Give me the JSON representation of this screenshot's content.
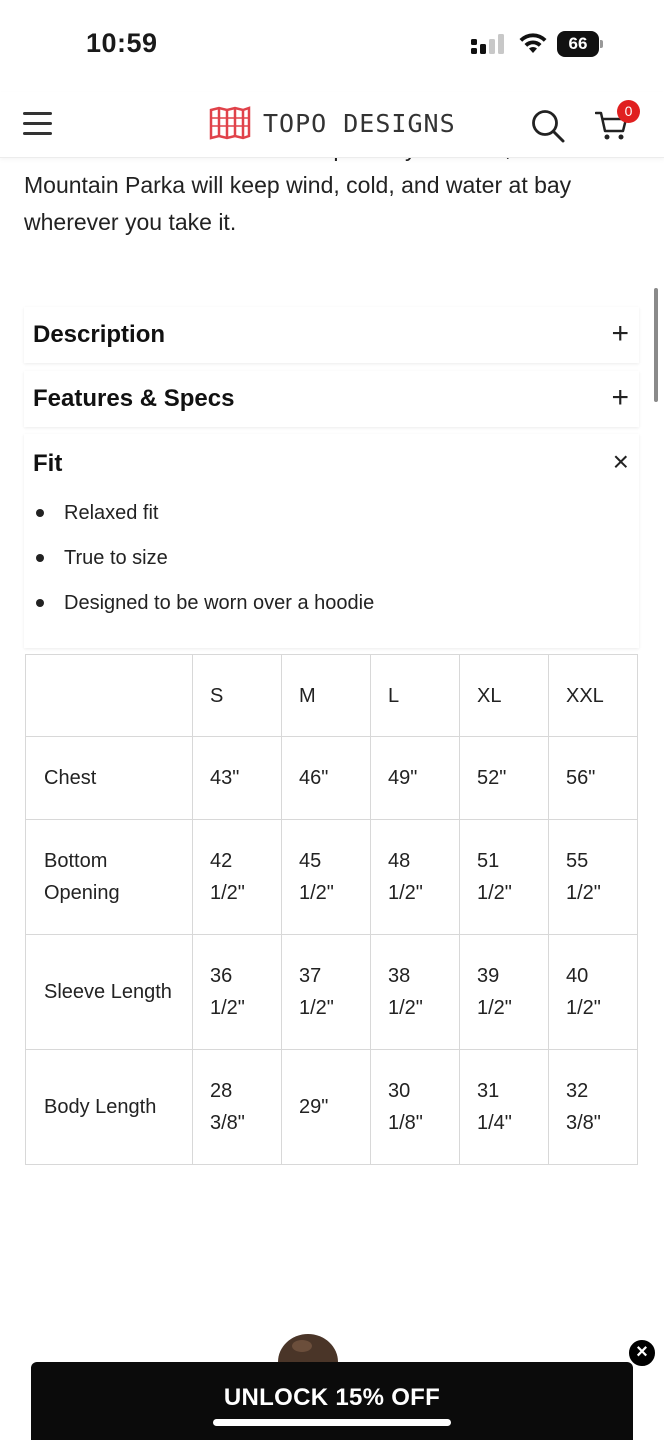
{
  "status_bar": {
    "time": "10:59",
    "battery": "66"
  },
  "header": {
    "brand": "TOPO DESIGNS",
    "cart_count": "0",
    "brand_color": "#e0424a"
  },
  "intro": {
    "text": "seams and a breathable waterproof nylon outer, the Mountain Parka will keep wind, cold, and water at bay wherever you take it."
  },
  "accordion": {
    "description": {
      "title": "Description",
      "toggle": "+"
    },
    "features": {
      "title": "Features & Specs",
      "toggle": "+"
    },
    "fit": {
      "title": "Fit",
      "toggle": "×",
      "items": [
        "Relaxed fit",
        "True to size",
        "Designed to be worn over a hoodie"
      ]
    }
  },
  "size_chart": {
    "headers": [
      "",
      "S",
      "M",
      "L",
      "XL",
      "XXL"
    ],
    "rows": [
      {
        "label": "Chest",
        "values": [
          "43\"",
          "46\"",
          "49\"",
          "52\"",
          "56\""
        ]
      },
      {
        "label": "Bottom Opening",
        "values": [
          "42 1/2\"",
          "45 1/2\"",
          "48 1/2\"",
          "51 1/2\"",
          "55 1/2\""
        ]
      },
      {
        "label": "Sleeve Length",
        "values": [
          "36 1/2\"",
          "37 1/2\"",
          "38 1/2\"",
          "39 1/2\"",
          "40 1/2\""
        ]
      },
      {
        "label": "Body Length",
        "values": [
          "28 3/8\"",
          "29\"",
          "30 1/8\"",
          "31 1/4\"",
          "32 3/8\""
        ]
      }
    ]
  },
  "promo": {
    "label": "UNLOCK 15% OFF",
    "close": "×"
  }
}
